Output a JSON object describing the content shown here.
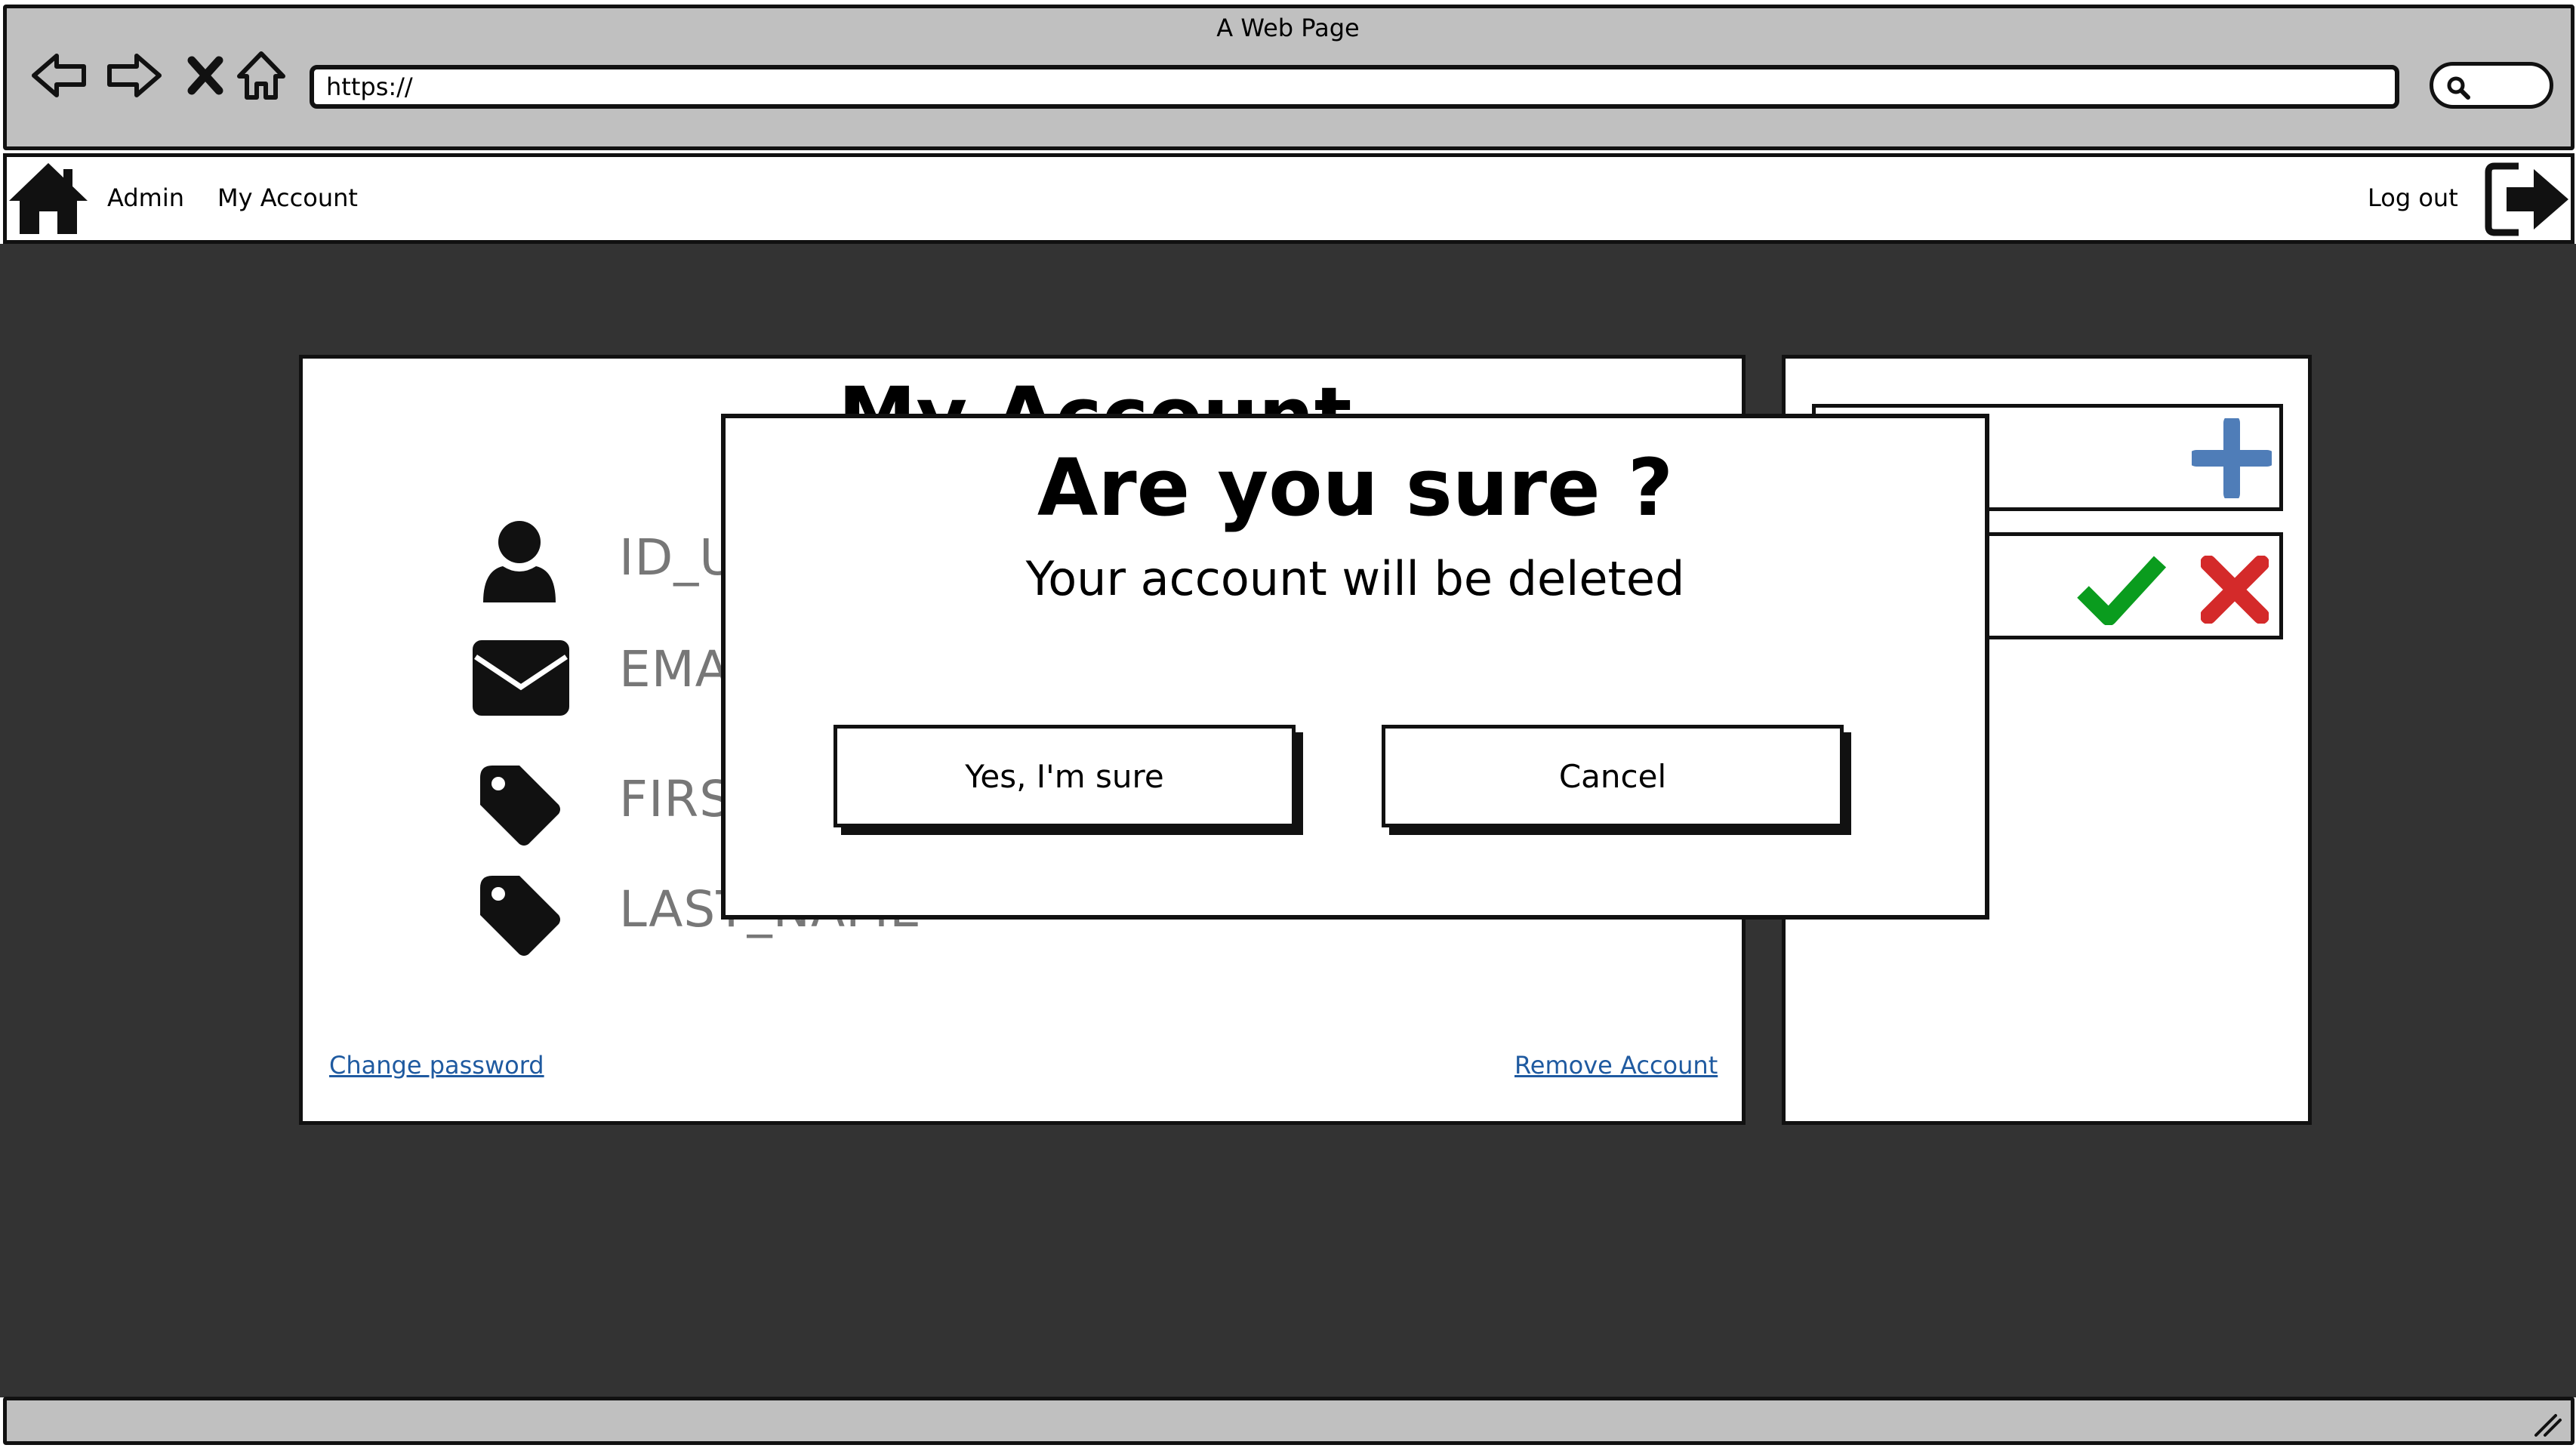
{
  "window": {
    "title": "A Web Page"
  },
  "address_bar": {
    "value": "https://"
  },
  "menu": {
    "admin": "Admin",
    "my_account": "My Account",
    "logout": "Log out"
  },
  "account_panel": {
    "title": "My Account",
    "fields": [
      "ID_USER",
      "EMAIL",
      "FIRST_NAME",
      "LAST_NAME"
    ],
    "change_password": "Change password",
    "remove_account": "Remove Account"
  },
  "dialog": {
    "title": "Are you sure ?",
    "message": "Your account will be deleted",
    "confirm": "Yes, I'm sure",
    "cancel": "Cancel"
  },
  "colors": {
    "add": "#4f7db8",
    "confirm": "#0a9c1e",
    "reject": "#d42a2a",
    "link": "#1f5aa0",
    "backdrop": "#333333"
  },
  "icons": [
    "back-icon",
    "forward-icon",
    "close-icon",
    "home-icon",
    "search-icon",
    "logout-icon",
    "user-icon",
    "envelope-icon",
    "tag-icon",
    "plus-icon",
    "check-icon",
    "x-icon",
    "resize-grip-icon"
  ]
}
